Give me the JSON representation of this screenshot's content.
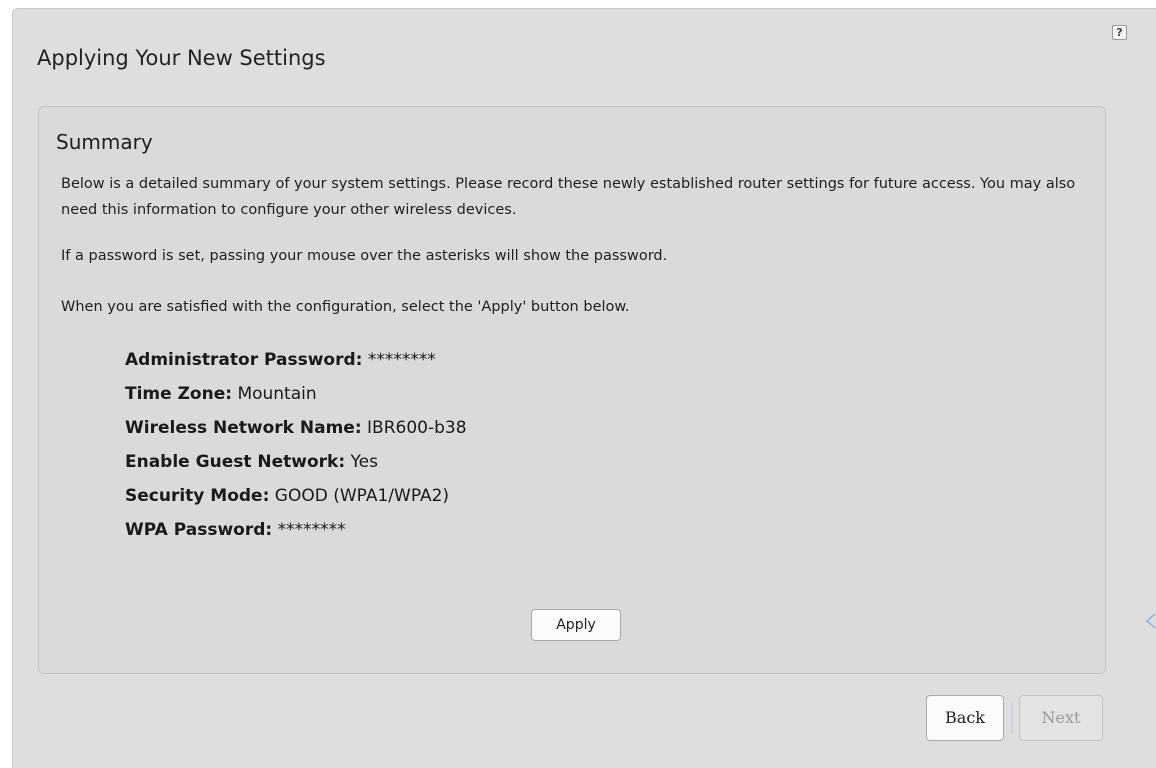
{
  "header": {
    "title": "Applying Your New Settings",
    "help_icon": "?"
  },
  "summary": {
    "heading": "Summary",
    "paragraphs": [
      "Below is a detailed summary of your system settings. Please record these newly established router settings for future access. You may also need this information to configure your other wireless devices.",
      "If a password is set, passing your mouse over the asterisks will show the password.",
      "When you are satisfied with the configuration, select the 'Apply' button below."
    ],
    "settings": [
      {
        "label": "Administrator Password:",
        "value": "********"
      },
      {
        "label": "Time Zone:",
        "value": "Mountain"
      },
      {
        "label": "Wireless Network Name:",
        "value": "IBR600-b38"
      },
      {
        "label": "Enable Guest Network:",
        "value": "Yes"
      },
      {
        "label": "Security Mode:",
        "value": "GOOD (WPA1/WPA2)"
      },
      {
        "label": "WPA Password:",
        "value": "********"
      }
    ],
    "apply_label": "Apply"
  },
  "navigation": {
    "back_label": "Back",
    "next_label": "Next",
    "next_enabled": false
  },
  "icons": {
    "help": "help-icon",
    "side_arrow": "chevron-left-icon"
  },
  "colors": {
    "panel_background": "#dedede",
    "summary_background": "#dadada",
    "arrow_accent": "#8fb0e8"
  }
}
